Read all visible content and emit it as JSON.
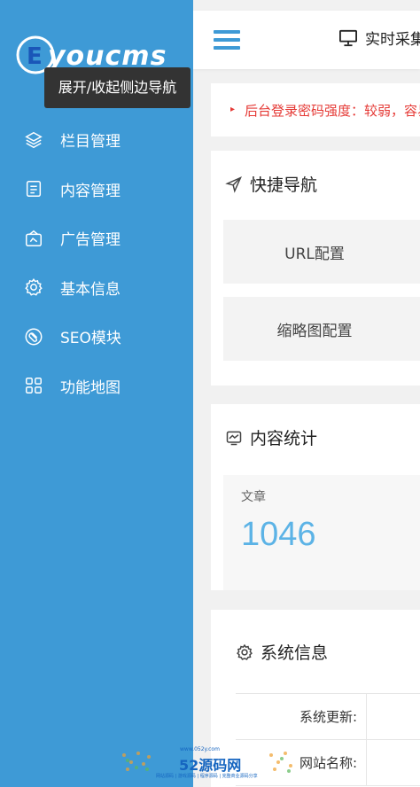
{
  "sidebar": {
    "brand": "EyouCMS",
    "brand_rest": "youcms",
    "tooltip": "展开/收起侧边导航",
    "items": [
      {
        "label": "栏目管理",
        "icon": "layers-icon"
      },
      {
        "label": "内容管理",
        "icon": "document-icon"
      },
      {
        "label": "广告管理",
        "icon": "ad-icon"
      },
      {
        "label": "基本信息",
        "icon": "gear-icon"
      },
      {
        "label": "SEO模块",
        "icon": "seo-icon"
      },
      {
        "label": "功能地图",
        "icon": "grid-icon"
      }
    ]
  },
  "topbar": {
    "action_label": "实时采集"
  },
  "alert": {
    "text": "后台登录密码强度：较弱，容易被破解"
  },
  "quick_nav": {
    "title": "快捷导航",
    "buttons": [
      "URL配置",
      "缩略图配置"
    ]
  },
  "content_stats": {
    "title": "内容统计",
    "label": "文章",
    "value": "1046"
  },
  "system_info": {
    "title": "系统信息",
    "rows": [
      {
        "key": "系统更新:"
      },
      {
        "key": "网站名称:"
      }
    ]
  },
  "watermark": {
    "site": "www.052y.com",
    "logo": "52源码网",
    "sub": "网站源码 | 游戏源码 | 程序源码 | 完整商业源码分享"
  },
  "colors": {
    "sidebar_bg": "#3e9ad6",
    "accent": "#3e9ad6",
    "alert": "#e53935",
    "stat_value": "#5cb3e6"
  }
}
